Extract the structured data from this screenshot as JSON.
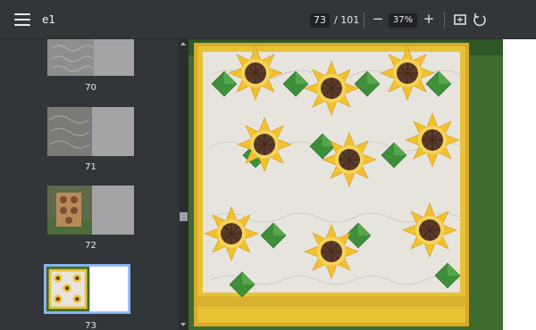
{
  "header": {
    "title": "e1",
    "page_current": "73",
    "page_total": "/ 101",
    "zoom": "37%",
    "zoom_out_label": "−",
    "zoom_in_label": "+"
  },
  "sidebar": {
    "thumbnails": [
      {
        "label": "70"
      },
      {
        "label": "71"
      },
      {
        "label": "72"
      },
      {
        "label": "73"
      }
    ]
  },
  "colors": {
    "toolbar_bg": "#323639",
    "viewer_bg": "#525659",
    "selected_thumb_border": "#8ab4f8",
    "quilt_border_yellow": "#e8c235",
    "sunflower_petal": "#f2c12e",
    "sunflower_center": "#5a3a28",
    "leaf_green": "#3d8f3a"
  }
}
